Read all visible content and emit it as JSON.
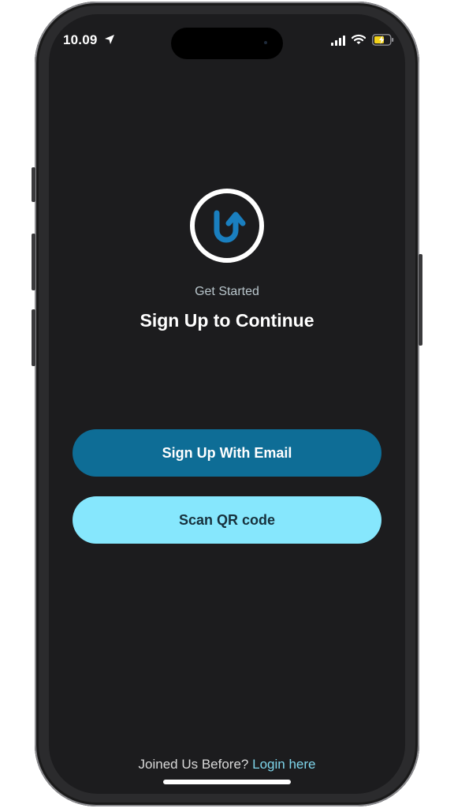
{
  "status_bar": {
    "time": "10.09",
    "icons": [
      "location-arrow-icon",
      "cellular-signal-icon",
      "wifi-icon",
      "battery-charging-icon"
    ]
  },
  "logo": {
    "icon": "upload-u-arrow-icon",
    "ring_color": "#ffffff",
    "mark_color": "#1a7fbf"
  },
  "header": {
    "subtitle": "Get Started",
    "title": "Sign Up to Continue"
  },
  "actions": {
    "email_button_label": "Sign Up With Email",
    "qr_button_label": "Scan QR code"
  },
  "footer": {
    "prompt": "Joined Us Before?",
    "login_link": "Login here"
  },
  "colors": {
    "background": "#1c1c1e",
    "primary_button": "#0e6d96",
    "secondary_button": "#86e7fd",
    "link": "#7fd6ec",
    "battery_fill": "#f2d21b"
  }
}
